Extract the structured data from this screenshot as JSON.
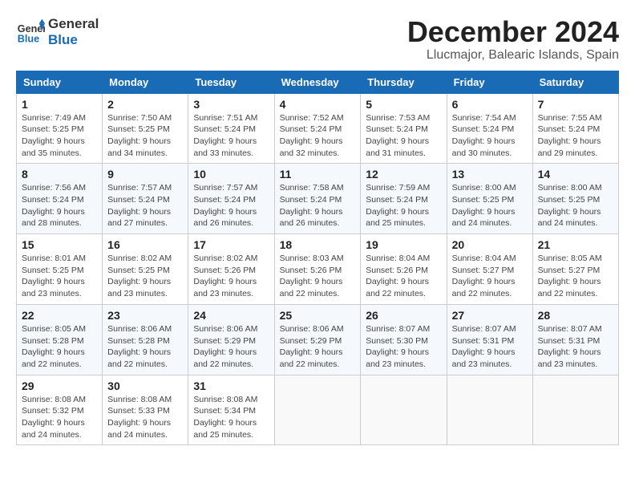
{
  "logo": {
    "line1": "General",
    "line2": "Blue"
  },
  "title": "December 2024",
  "location": "Llucmajor, Balearic Islands, Spain",
  "headers": [
    "Sunday",
    "Monday",
    "Tuesday",
    "Wednesday",
    "Thursday",
    "Friday",
    "Saturday"
  ],
  "weeks": [
    [
      {
        "day": "1",
        "sunrise": "Sunrise: 7:49 AM",
        "sunset": "Sunset: 5:25 PM",
        "daylight": "Daylight: 9 hours and 35 minutes."
      },
      {
        "day": "2",
        "sunrise": "Sunrise: 7:50 AM",
        "sunset": "Sunset: 5:25 PM",
        "daylight": "Daylight: 9 hours and 34 minutes."
      },
      {
        "day": "3",
        "sunrise": "Sunrise: 7:51 AM",
        "sunset": "Sunset: 5:24 PM",
        "daylight": "Daylight: 9 hours and 33 minutes."
      },
      {
        "day": "4",
        "sunrise": "Sunrise: 7:52 AM",
        "sunset": "Sunset: 5:24 PM",
        "daylight": "Daylight: 9 hours and 32 minutes."
      },
      {
        "day": "5",
        "sunrise": "Sunrise: 7:53 AM",
        "sunset": "Sunset: 5:24 PM",
        "daylight": "Daylight: 9 hours and 31 minutes."
      },
      {
        "day": "6",
        "sunrise": "Sunrise: 7:54 AM",
        "sunset": "Sunset: 5:24 PM",
        "daylight": "Daylight: 9 hours and 30 minutes."
      },
      {
        "day": "7",
        "sunrise": "Sunrise: 7:55 AM",
        "sunset": "Sunset: 5:24 PM",
        "daylight": "Daylight: 9 hours and 29 minutes."
      }
    ],
    [
      {
        "day": "8",
        "sunrise": "Sunrise: 7:56 AM",
        "sunset": "Sunset: 5:24 PM",
        "daylight": "Daylight: 9 hours and 28 minutes."
      },
      {
        "day": "9",
        "sunrise": "Sunrise: 7:57 AM",
        "sunset": "Sunset: 5:24 PM",
        "daylight": "Daylight: 9 hours and 27 minutes."
      },
      {
        "day": "10",
        "sunrise": "Sunrise: 7:57 AM",
        "sunset": "Sunset: 5:24 PM",
        "daylight": "Daylight: 9 hours and 26 minutes."
      },
      {
        "day": "11",
        "sunrise": "Sunrise: 7:58 AM",
        "sunset": "Sunset: 5:24 PM",
        "daylight": "Daylight: 9 hours and 26 minutes."
      },
      {
        "day": "12",
        "sunrise": "Sunrise: 7:59 AM",
        "sunset": "Sunset: 5:24 PM",
        "daylight": "Daylight: 9 hours and 25 minutes."
      },
      {
        "day": "13",
        "sunrise": "Sunrise: 8:00 AM",
        "sunset": "Sunset: 5:25 PM",
        "daylight": "Daylight: 9 hours and 24 minutes."
      },
      {
        "day": "14",
        "sunrise": "Sunrise: 8:00 AM",
        "sunset": "Sunset: 5:25 PM",
        "daylight": "Daylight: 9 hours and 24 minutes."
      }
    ],
    [
      {
        "day": "15",
        "sunrise": "Sunrise: 8:01 AM",
        "sunset": "Sunset: 5:25 PM",
        "daylight": "Daylight: 9 hours and 23 minutes."
      },
      {
        "day": "16",
        "sunrise": "Sunrise: 8:02 AM",
        "sunset": "Sunset: 5:25 PM",
        "daylight": "Daylight: 9 hours and 23 minutes."
      },
      {
        "day": "17",
        "sunrise": "Sunrise: 8:02 AM",
        "sunset": "Sunset: 5:26 PM",
        "daylight": "Daylight: 9 hours and 23 minutes."
      },
      {
        "day": "18",
        "sunrise": "Sunrise: 8:03 AM",
        "sunset": "Sunset: 5:26 PM",
        "daylight": "Daylight: 9 hours and 22 minutes."
      },
      {
        "day": "19",
        "sunrise": "Sunrise: 8:04 AM",
        "sunset": "Sunset: 5:26 PM",
        "daylight": "Daylight: 9 hours and 22 minutes."
      },
      {
        "day": "20",
        "sunrise": "Sunrise: 8:04 AM",
        "sunset": "Sunset: 5:27 PM",
        "daylight": "Daylight: 9 hours and 22 minutes."
      },
      {
        "day": "21",
        "sunrise": "Sunrise: 8:05 AM",
        "sunset": "Sunset: 5:27 PM",
        "daylight": "Daylight: 9 hours and 22 minutes."
      }
    ],
    [
      {
        "day": "22",
        "sunrise": "Sunrise: 8:05 AM",
        "sunset": "Sunset: 5:28 PM",
        "daylight": "Daylight: 9 hours and 22 minutes."
      },
      {
        "day": "23",
        "sunrise": "Sunrise: 8:06 AM",
        "sunset": "Sunset: 5:28 PM",
        "daylight": "Daylight: 9 hours and 22 minutes."
      },
      {
        "day": "24",
        "sunrise": "Sunrise: 8:06 AM",
        "sunset": "Sunset: 5:29 PM",
        "daylight": "Daylight: 9 hours and 22 minutes."
      },
      {
        "day": "25",
        "sunrise": "Sunrise: 8:06 AM",
        "sunset": "Sunset: 5:29 PM",
        "daylight": "Daylight: 9 hours and 22 minutes."
      },
      {
        "day": "26",
        "sunrise": "Sunrise: 8:07 AM",
        "sunset": "Sunset: 5:30 PM",
        "daylight": "Daylight: 9 hours and 23 minutes."
      },
      {
        "day": "27",
        "sunrise": "Sunrise: 8:07 AM",
        "sunset": "Sunset: 5:31 PM",
        "daylight": "Daylight: 9 hours and 23 minutes."
      },
      {
        "day": "28",
        "sunrise": "Sunrise: 8:07 AM",
        "sunset": "Sunset: 5:31 PM",
        "daylight": "Daylight: 9 hours and 23 minutes."
      }
    ],
    [
      {
        "day": "29",
        "sunrise": "Sunrise: 8:08 AM",
        "sunset": "Sunset: 5:32 PM",
        "daylight": "Daylight: 9 hours and 24 minutes."
      },
      {
        "day": "30",
        "sunrise": "Sunrise: 8:08 AM",
        "sunset": "Sunset: 5:33 PM",
        "daylight": "Daylight: 9 hours and 24 minutes."
      },
      {
        "day": "31",
        "sunrise": "Sunrise: 8:08 AM",
        "sunset": "Sunset: 5:34 PM",
        "daylight": "Daylight: 9 hours and 25 minutes."
      },
      null,
      null,
      null,
      null
    ]
  ]
}
